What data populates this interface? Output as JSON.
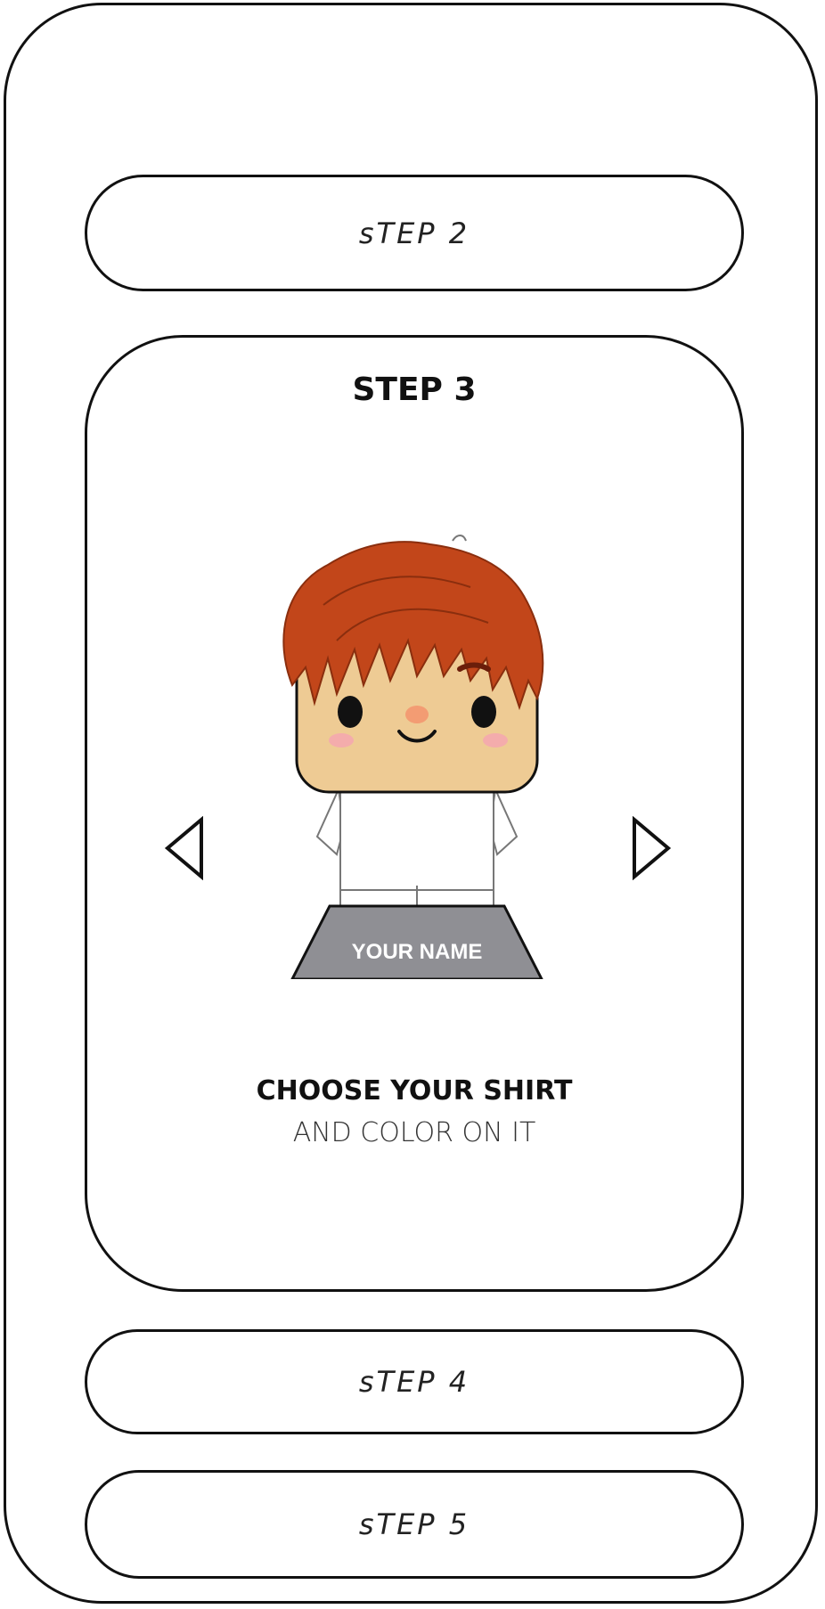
{
  "steps": {
    "step2_label": "sTEP 2",
    "step3_title": "STEP 3",
    "step4_label": "sTEP 4",
    "step5_label": "sTEP 5"
  },
  "character": {
    "nameplate_text": "YOUR NAME"
  },
  "caption": {
    "main": "CHOOSE YOUR SHIRT",
    "sub": "AND COLOR ON IT"
  },
  "icons": {
    "prev": "triangle-left-icon",
    "next": "triangle-right-icon"
  },
  "colors": {
    "hair": "#C2461A",
    "skin": "#EECB94",
    "nameplate": "#8F8F94"
  }
}
